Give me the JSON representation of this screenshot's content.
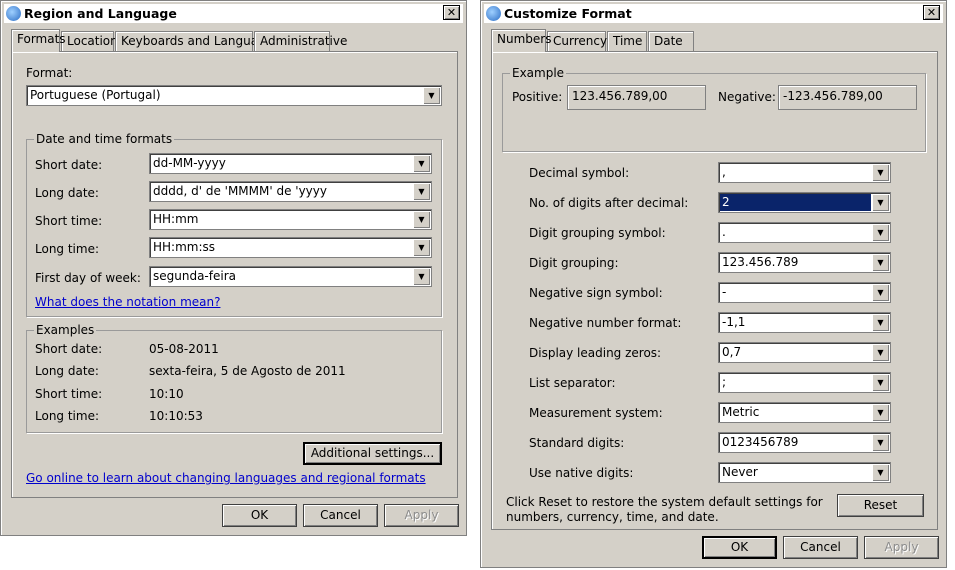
{
  "left_window": {
    "title": "Region and Language",
    "close": "✕",
    "tabs": [
      "Formats",
      "Location",
      "Keyboards and Languages",
      "Administrative"
    ],
    "format_label": "Format:",
    "format_value": "Portuguese (Portugal)",
    "datetime_group": "Date and time formats",
    "short_date_label": "Short date:",
    "short_date_value": "dd-MM-yyyy",
    "long_date_label": "Long date:",
    "long_date_value": "dddd, d' de 'MMMM' de 'yyyy",
    "short_time_label": "Short time:",
    "short_time_value": "HH:mm",
    "long_time_label": "Long time:",
    "long_time_value": "HH:mm:ss",
    "first_day_label": "First day of week:",
    "first_day_value": "segunda-feira",
    "notation_link": "What does the notation mean?",
    "examples_group": "Examples",
    "ex_short_date_label": "Short date:",
    "ex_short_date": "05-08-2011",
    "ex_long_date_label": "Long date:",
    "ex_long_date": "sexta-feira, 5 de Agosto de 2011",
    "ex_short_time_label": "Short time:",
    "ex_short_time": "10:10",
    "ex_long_time_label": "Long time:",
    "ex_long_time": "10:10:53",
    "additional_settings": "Additional settings...",
    "online_link": "Go online to learn about changing languages and regional formats",
    "ok": "OK",
    "cancel": "Cancel",
    "apply": "Apply"
  },
  "right_window": {
    "title": "Customize Format",
    "close": "✕",
    "tabs": [
      "Numbers",
      "Currency",
      "Time",
      "Date"
    ],
    "example_group": "Example",
    "positive_label": "Positive:",
    "positive_value": "123.456.789,00",
    "negative_label": "Negative:",
    "negative_value": "-123.456.789,00",
    "settings": [
      {
        "label": "Decimal symbol:",
        "value": ","
      },
      {
        "label": "No. of digits after decimal:",
        "value": "2"
      },
      {
        "label": "Digit grouping symbol:",
        "value": "."
      },
      {
        "label": "Digit grouping:",
        "value": "123.456.789"
      },
      {
        "label": "Negative sign symbol:",
        "value": "-"
      },
      {
        "label": "Negative number format:",
        "value": "-1,1"
      },
      {
        "label": "Display leading zeros:",
        "value": "0,7"
      },
      {
        "label": "List separator:",
        "value": ";"
      },
      {
        "label": "Measurement system:",
        "value": "Metric"
      },
      {
        "label": "Standard digits:",
        "value": "0123456789"
      },
      {
        "label": "Use native digits:",
        "value": "Never"
      }
    ],
    "reset_text_1": "Click Reset to restore the system default settings for",
    "reset_text_2": "numbers, currency, time, and date.",
    "reset": "Reset",
    "ok": "OK",
    "cancel": "Cancel",
    "apply": "Apply"
  }
}
